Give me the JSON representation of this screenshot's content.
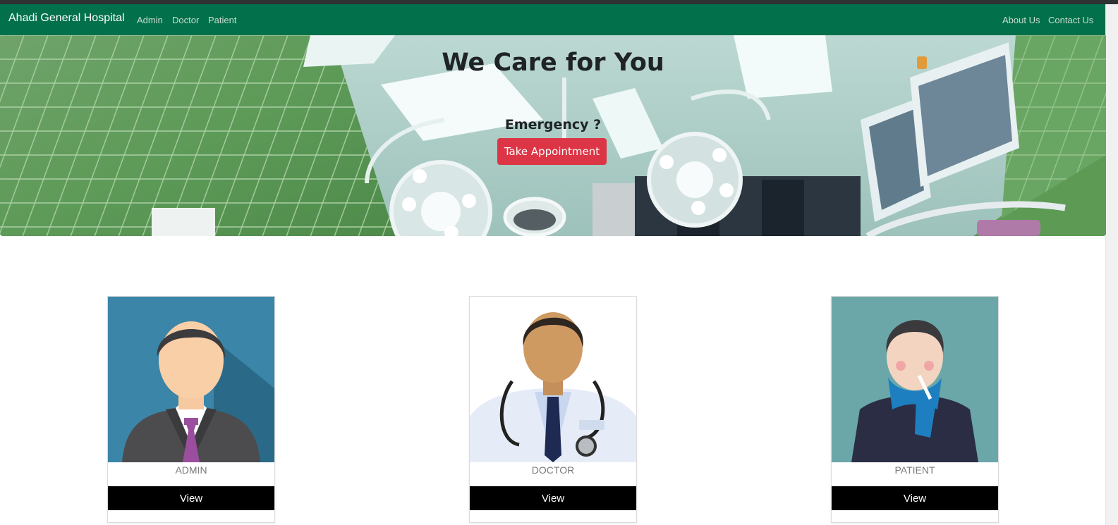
{
  "navbar": {
    "brand": "Ahadi General Hospital",
    "left_links": [
      "Admin",
      "Doctor",
      "Patient"
    ],
    "right_links": [
      "About Us",
      "Contact Us"
    ],
    "color": "#02704a"
  },
  "hero": {
    "title": "We Care for You",
    "emergency": "Emergency ?",
    "button": "Take Appointment",
    "button_color": "#dc3545"
  },
  "cards": [
    {
      "label": "ADMIN",
      "button": "View",
      "image": "admin-avatar-icon"
    },
    {
      "label": "DOCTOR",
      "button": "View",
      "image": "doctor-avatar-icon"
    },
    {
      "label": "PATIENT",
      "button": "View",
      "image": "patient-avatar-icon"
    }
  ]
}
